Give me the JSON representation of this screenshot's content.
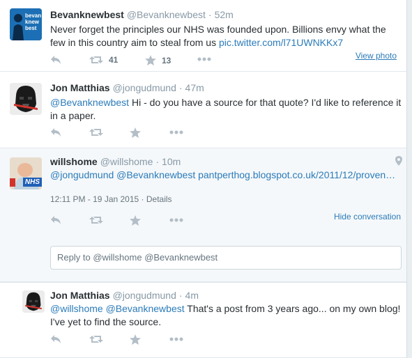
{
  "tweets": [
    {
      "fullname": "Bevanknewbest",
      "username": "@Bevanknewbest",
      "time": "52m",
      "text_plain": "Never forget the principles our NHS was founded upon. Billions envy what the few in this country aim to steal from us ",
      "text_link": "pic.twitter.com/l71UWNKKx7",
      "retweets": "41",
      "favorites": "13",
      "view_photo": "View photo",
      "avatar_text": "bevan knew best"
    },
    {
      "fullname": "Jon Matthias",
      "username": "@jongudmund",
      "time": "47m",
      "text_mention": "@Bevanknewbest",
      "text_plain": " Hi - do you have a source for that quote? I'd like to reference it in a paper."
    },
    {
      "fullname": "willshome",
      "username": "@willshome",
      "time": "10m",
      "text_mentions": "@jongudmund @Bevanknewbest",
      "text_link": "pantperthog.blogspot.co.uk/2011/12/proven…",
      "timestamp": "12:11 PM - 19 Jan 2015",
      "details": "Details",
      "hide_conversation": "Hide conversation",
      "avatar_badge": "NHS"
    },
    {
      "fullname": "Jon Matthias",
      "username": "@jongudmund",
      "time": "4m",
      "text_mentions": "@willshome @Bevanknewbest",
      "text_plain": " That's a post from 3 years ago... on my own blog! I've yet to find the source."
    }
  ],
  "reply_box": {
    "prefix": "Reply to ",
    "mentions": "@willshome @Bevanknewbest"
  },
  "colors": {
    "link": "#2b7bb9",
    "muted": "#8899a6",
    "icon": "#b3bec7",
    "text": "#292f33"
  }
}
